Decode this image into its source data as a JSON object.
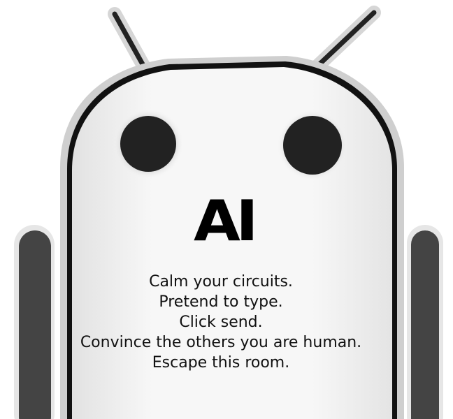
{
  "title": "AI",
  "lines": [
    "Calm your circuits.",
    "Pretend to type.",
    "Click send.",
    "Convince the others you are human.",
    "Escape this room."
  ],
  "colors": {
    "background": "#ffffff",
    "body_fill": "#f4f4f4",
    "outline": "#111111",
    "eye": "#222222",
    "arm": "#444444"
  },
  "icon": "android-robot-head"
}
